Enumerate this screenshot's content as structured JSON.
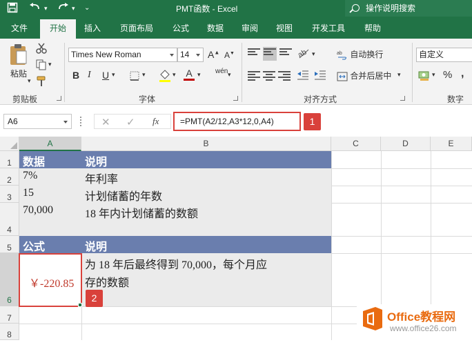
{
  "window": {
    "title": "PMT函数  -  Excel",
    "tell_me": "操作说明搜索"
  },
  "tabs": [
    "文件",
    "开始",
    "插入",
    "页面布局",
    "公式",
    "数据",
    "审阅",
    "视图",
    "开发工具",
    "帮助"
  ],
  "ribbon": {
    "paste_label": "粘贴",
    "clipboard_group": "剪贴板",
    "font_name": "Times New Roman",
    "font_size": "14",
    "font_group": "字体",
    "bold": "B",
    "italic": "I",
    "underline": "U",
    "grow_font": "A",
    "shrink_font": "A",
    "font_color_glyph": "A",
    "phonetic_glyph": "wén",
    "wrap_text": "自动换行",
    "merge_center": "合并后居中",
    "align_group": "对齐方式",
    "number_format": "自定义",
    "number_group": "数字",
    "percent": "%",
    "comma": ","
  },
  "formula_bar": {
    "name_box": "A6",
    "fx": "fx",
    "formula": "=PMT(A2/12,A3*12,0,A4)",
    "marker1": "1"
  },
  "grid": {
    "columns": [
      "A",
      "B",
      "C",
      "D",
      "E"
    ],
    "rows": [
      "1",
      "2",
      "3",
      "4",
      "5",
      "6",
      "7",
      "8"
    ],
    "cells": {
      "a1": "数据",
      "b1": "说明",
      "a2": "7%",
      "b2": "年利率",
      "a3": "15",
      "b3": "计划储蓄的年数",
      "a4": "70,000",
      "b4": "18  年内计划储蓄的数额",
      "a5": "公式",
      "b5": "说明",
      "a6": "￥-220.85",
      "b6_line1": "为  18  年后最终得到  70,000，每个月应",
      "b6_line2": "存的数额"
    },
    "marker2": "2"
  },
  "watermark": {
    "brand": "Office教程网",
    "url": "www.office26.com"
  },
  "colors": {
    "excel_green": "#217346",
    "header_band": "#6a7eae",
    "highlight_red": "#d9413b",
    "result_red": "#c0392b"
  }
}
